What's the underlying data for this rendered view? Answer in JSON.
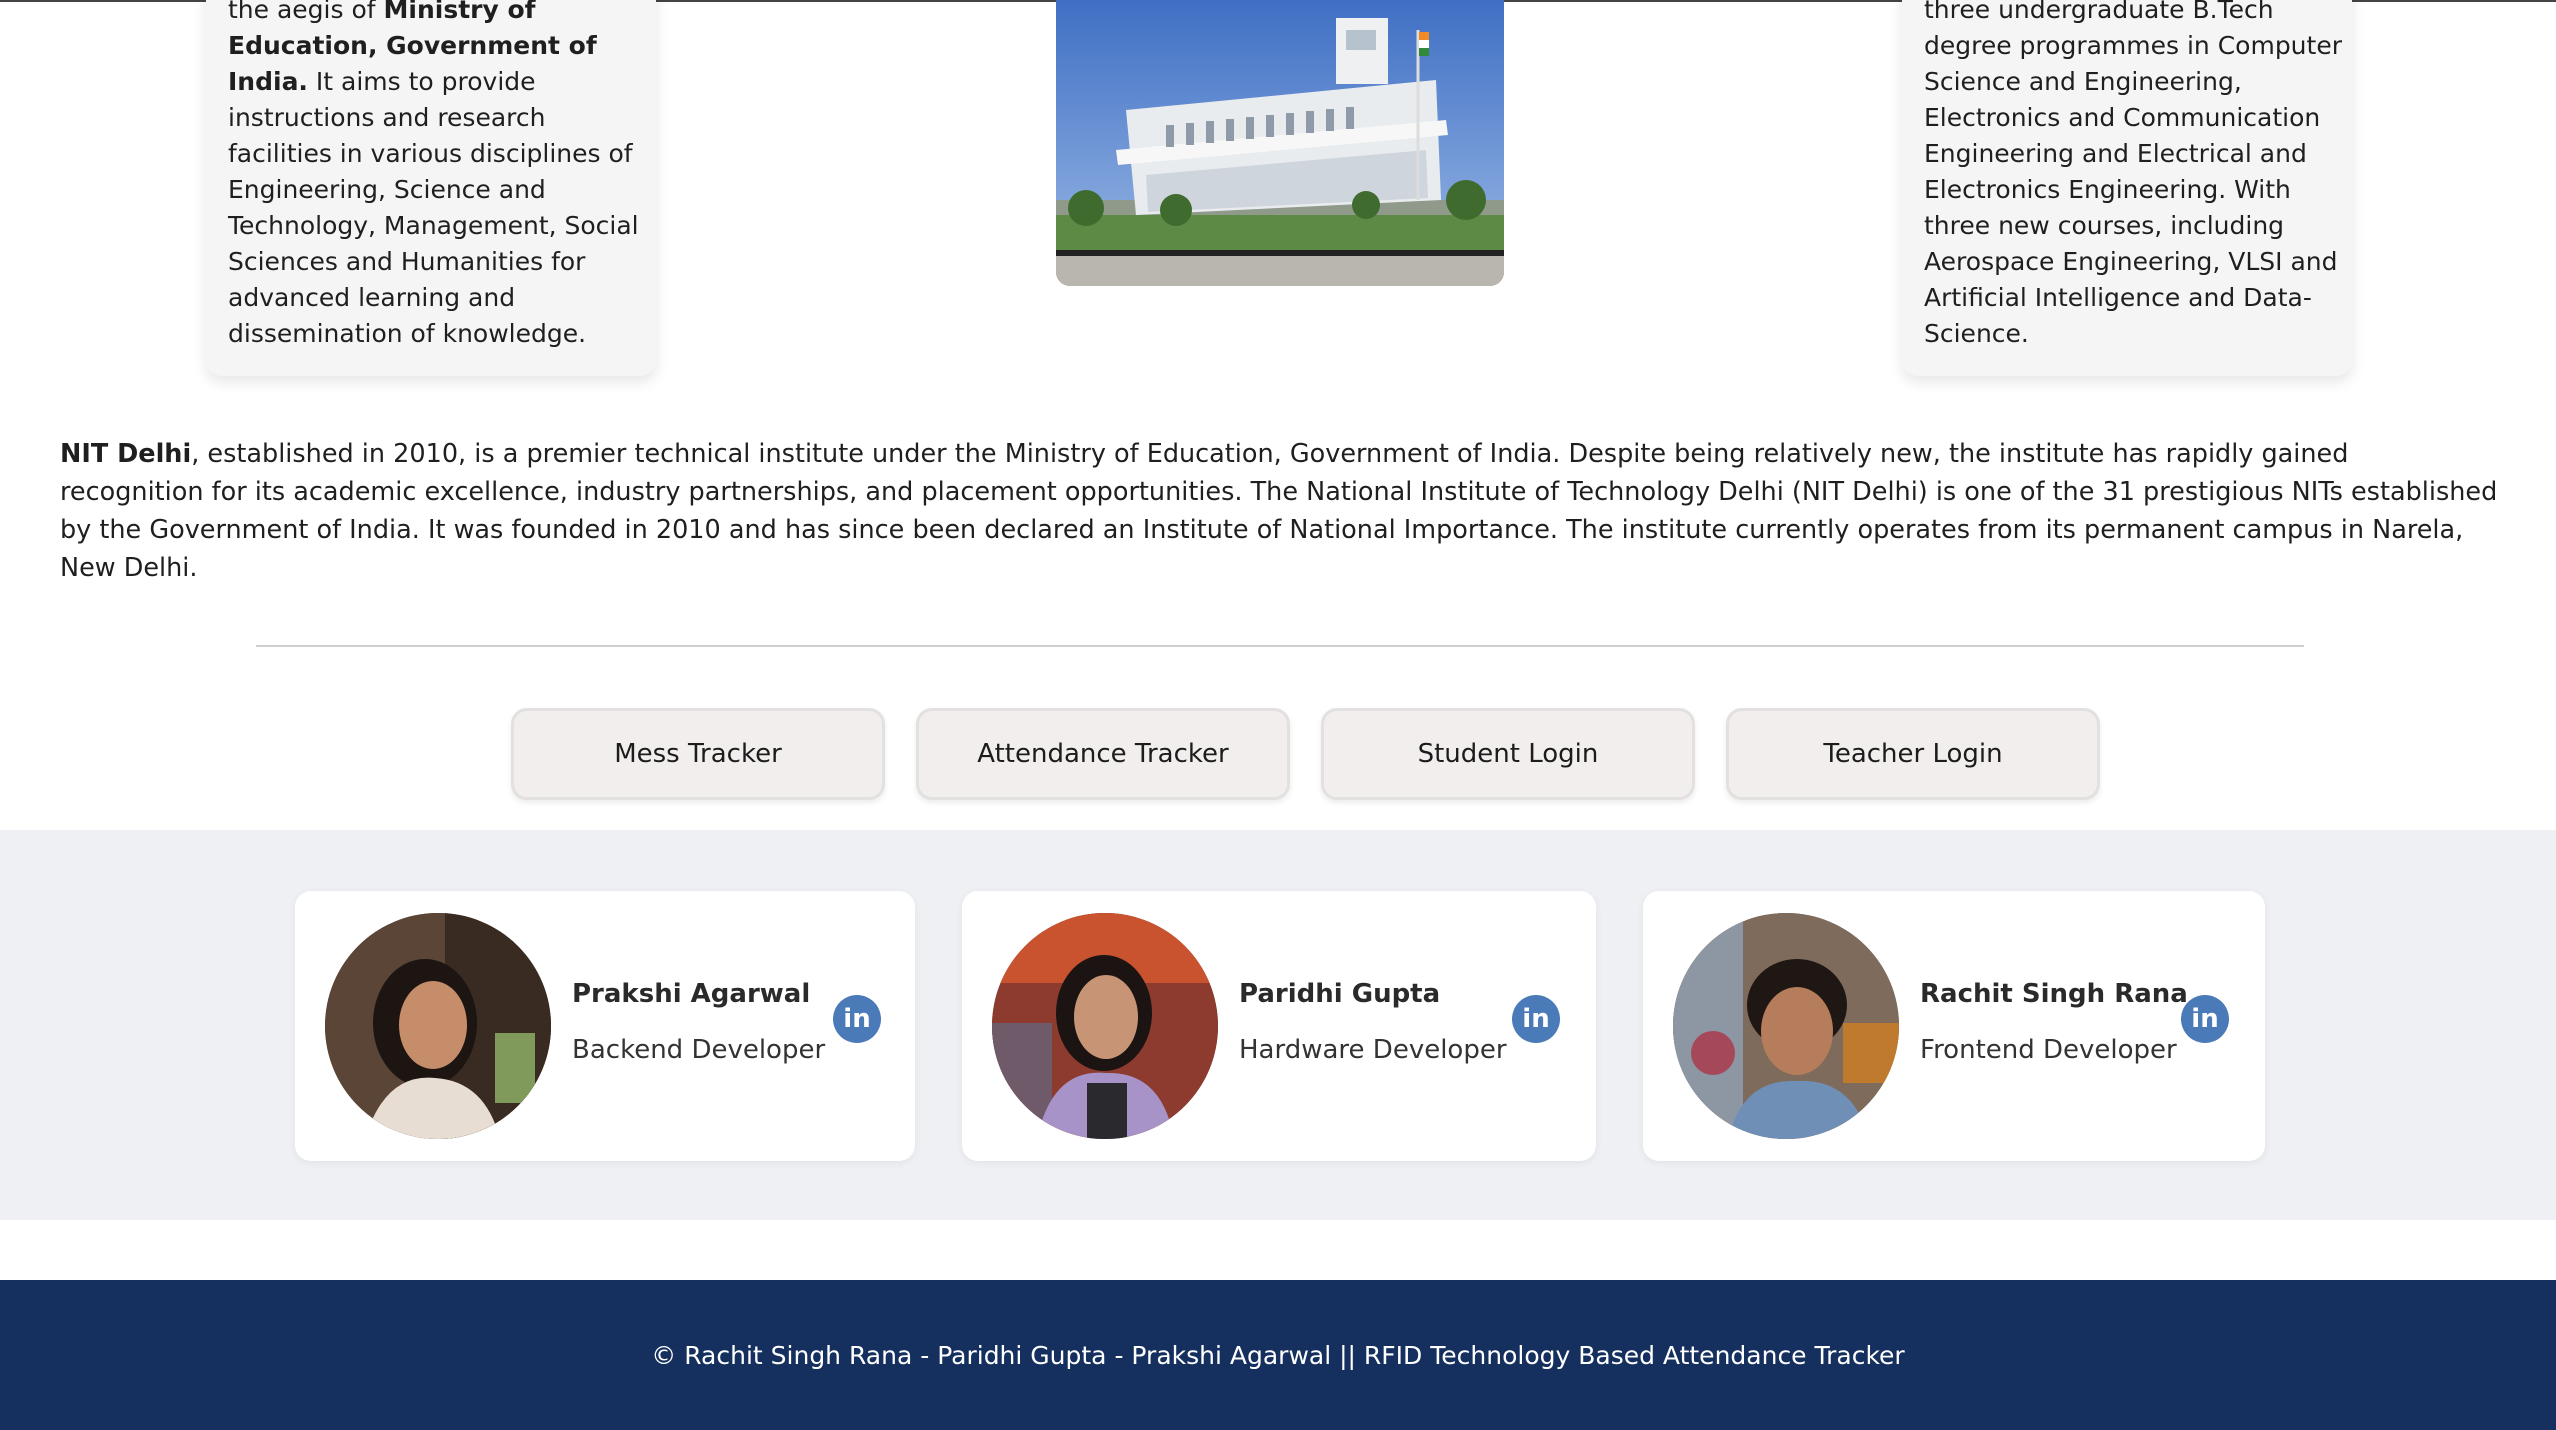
{
  "info_left": {
    "line_intro": "the aegis of ",
    "ministry_bold": "Ministry of Education, Government of India.",
    "body": " It aims to provide instructions and research facilities in various disciplines of Engineering, Science and Technology, Management, Social Sciences and Humanities for advanced learning and dissemination of knowledge."
  },
  "info_right": {
    "body": "three undergraduate B.Tech degree programmes in Computer Science and Engineering, Electronics and Communication Engineering and Electrical and Electronics Engineering. With three new courses, including Aerospace Engineering, VLSI and Artificial Intelligence and Data-Science."
  },
  "about": {
    "name_bold": "NIT Delhi",
    "text": ", established in 2010, is a premier technical institute under the Ministry of Education, Government of India. Despite being relatively new, the institute has rapidly gained recognition for its academic excellence, industry partnerships, and placement opportunities. The National Institute of Technology Delhi (NIT Delhi) is one of the 31 prestigious NITs established by the Government of India. It was founded in 2010 and has since been declared an Institute of National Importance. The institute currently operates from its permanent campus in Narela, New Delhi."
  },
  "nav": {
    "mess": "Mess Tracker",
    "attendance": "Attendance Tracker",
    "student": "Student Login",
    "teacher": "Teacher Login"
  },
  "team": [
    {
      "name": "Prakshi Agarwal",
      "role": "Backend Developer"
    },
    {
      "name": "Paridhi Gupta",
      "role": "Hardware Developer"
    },
    {
      "name": "Rachit Singh Rana",
      "role": "Frontend Developer"
    }
  ],
  "icons": {
    "linkedin": "linkedin-icon",
    "linkedin_glyph": "in"
  },
  "colors": {
    "footer_bg": "#15305e",
    "linkedin_blue": "#4a7ab8",
    "team_band": "#eef0f4"
  },
  "footer": {
    "text": "© Rachit Singh Rana - Paridhi Gupta - Prakshi Agarwal || RFID Technology Based Attendance Tracker"
  }
}
